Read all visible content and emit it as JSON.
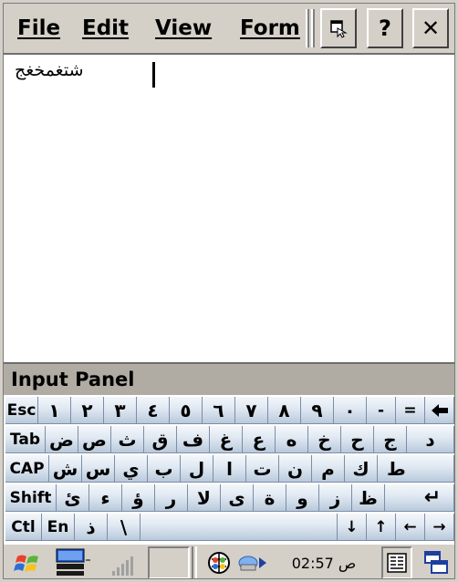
{
  "menu": {
    "items": [
      {
        "label": "File"
      },
      {
        "label": "Edit"
      },
      {
        "label": "View"
      },
      {
        "label": "Form"
      }
    ],
    "buttons": {
      "help_label": "?",
      "close_label": "✕"
    }
  },
  "editor": {
    "text": "شتغمخغج"
  },
  "input_panel": {
    "title": "Input Panel",
    "rows": [
      [
        "Esc",
        "١",
        "٢",
        "٣",
        "٤",
        "٥",
        "٦",
        "٧",
        "٨",
        "٩",
        "٠",
        "-",
        "=",
        "◆"
      ],
      [
        "Tab",
        "ض",
        "ص",
        "ث",
        "ق",
        "ف",
        "غ",
        "ع",
        "ه",
        "خ",
        "ح",
        "ج",
        "د"
      ],
      [
        "CAP",
        "ش",
        "س",
        "ي",
        "ب",
        "ل",
        "ا",
        "ت",
        "ن",
        "م",
        "ك",
        "ط"
      ],
      [
        "Shift",
        "ئ",
        "ء",
        "ؤ",
        "ر",
        "لا",
        "ى",
        "ة",
        "و",
        "ز",
        "ظ",
        "↵"
      ],
      [
        "Ctl",
        "En",
        "ذ",
        "\\",
        " ",
        "↓",
        "↑",
        "←",
        "→"
      ]
    ]
  },
  "taskbar": {
    "time": "02:57 ص"
  }
}
